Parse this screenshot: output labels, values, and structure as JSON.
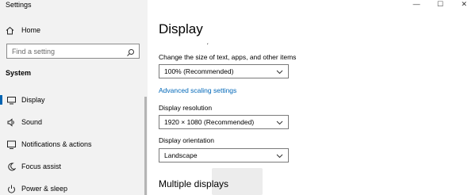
{
  "app": {
    "title": "Settings"
  },
  "window": {
    "minimize": "—",
    "maximize": "☐",
    "close": "✕"
  },
  "sidebar": {
    "home_label": "Home",
    "search_placeholder": "Find a setting",
    "section": "System",
    "items": [
      {
        "label": "Display",
        "icon": "monitor-icon",
        "active": true
      },
      {
        "label": "Sound",
        "icon": "speaker-icon",
        "active": false
      },
      {
        "label": "Notifications & actions",
        "icon": "notification-icon",
        "active": false
      },
      {
        "label": "Focus assist",
        "icon": "moon-icon",
        "active": false
      },
      {
        "label": "Power & sleep",
        "icon": "power-icon",
        "active": false
      }
    ]
  },
  "main": {
    "title": "Display",
    "scale": {
      "label": "Change the size of text, apps, and other items",
      "value": "100% (Recommended)"
    },
    "advanced_link": "Advanced scaling settings",
    "resolution": {
      "label": "Display resolution",
      "value": "1920 × 1080 (Recommended)"
    },
    "orientation": {
      "label": "Display orientation",
      "value": "Landscape"
    },
    "multiple_displays_title": "Multiple displays"
  },
  "colors": {
    "accent": "#0063b1",
    "link": "#0067b8",
    "sidebar_bg": "#f2f2f2"
  }
}
